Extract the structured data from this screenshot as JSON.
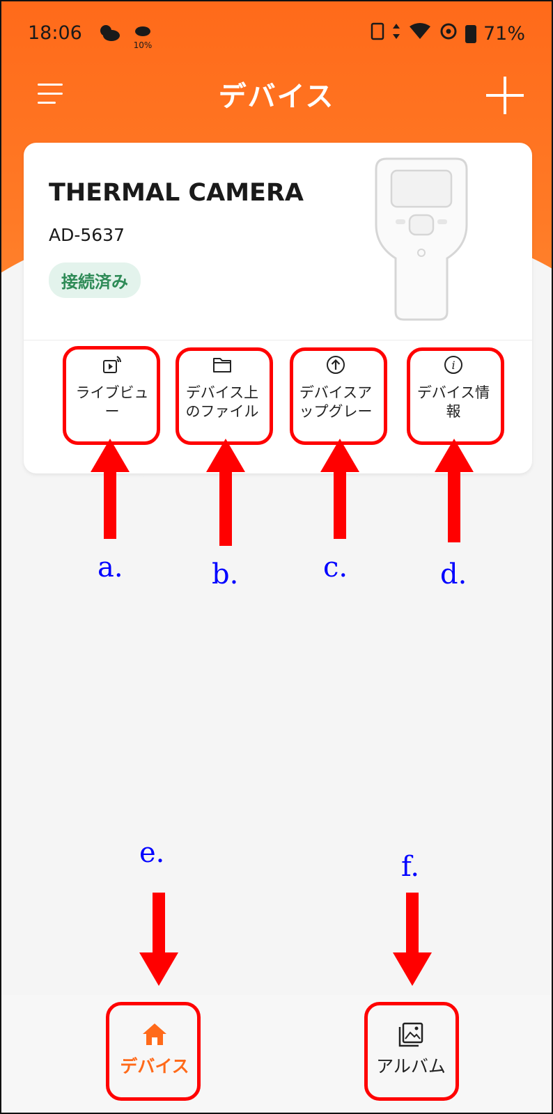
{
  "status_bar": {
    "time": "18:06",
    "rain_label": "10%",
    "battery": "71%"
  },
  "app_bar": {
    "title": "デバイス"
  },
  "device_card": {
    "name": "THERMAL CAMERA",
    "model": "AD-5637",
    "status": "接続済み"
  },
  "actions": [
    {
      "label_line1": "ライブビュ",
      "label_line2": "ー",
      "icon": "live-view-icon"
    },
    {
      "label_line1": "デバイス上",
      "label_line2": "のファイル",
      "icon": "folder-icon"
    },
    {
      "label_line1": "デバイスア",
      "label_line2": "ップグレー",
      "icon": "upgrade-icon"
    },
    {
      "label_line1": "デバイス情",
      "label_line2": "報",
      "icon": "info-icon"
    }
  ],
  "annotations": {
    "a": "a.",
    "b": "b.",
    "c": "c.",
    "d": "d.",
    "e": "e.",
    "f": "f."
  },
  "bottom_nav": {
    "items": [
      {
        "label": "デバイス",
        "icon": "home-icon",
        "active": true
      },
      {
        "label": "アルバム",
        "icon": "album-icon",
        "active": false
      }
    ]
  },
  "colors": {
    "accent": "#ff6a1a",
    "highlight": "#ff0000",
    "annotation_text": "#0000ff",
    "connected": "#2e8b57"
  }
}
